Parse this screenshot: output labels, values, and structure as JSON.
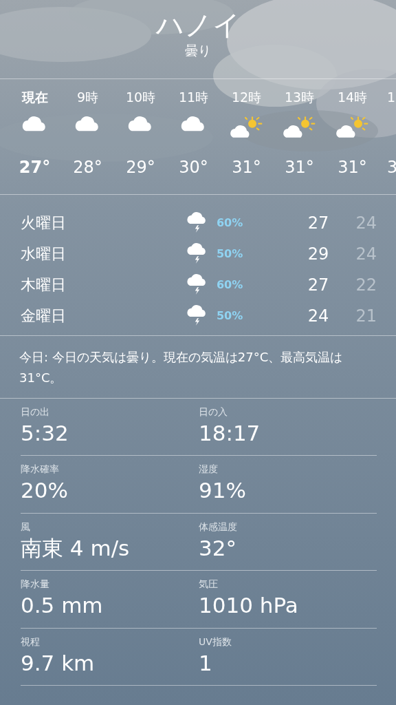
{
  "location": {
    "city": "ハノイ",
    "condition": "曇り"
  },
  "hourly": [
    {
      "time": "現在",
      "kind": "cloudy",
      "temp": "27°",
      "now": true
    },
    {
      "time": "9時",
      "kind": "cloudy",
      "temp": "28°",
      "now": false
    },
    {
      "time": "10時",
      "kind": "cloudy",
      "temp": "29°",
      "now": false
    },
    {
      "time": "11時",
      "kind": "cloudy",
      "temp": "30°",
      "now": false
    },
    {
      "time": "12時",
      "kind": "partly-sunny",
      "temp": "31°",
      "now": false
    },
    {
      "time": "13時",
      "kind": "partly-sunny",
      "temp": "31°",
      "now": false
    },
    {
      "time": "14時",
      "kind": "partly-sunny",
      "temp": "31°",
      "now": false
    },
    {
      "time": "1",
      "temp": "3",
      "now": false
    }
  ],
  "daily": [
    {
      "day": "火曜日",
      "kind": "thunderstorm",
      "chance": "60%",
      "high": "27",
      "low": "24"
    },
    {
      "day": "水曜日",
      "kind": "thunderstorm",
      "chance": "50%",
      "high": "29",
      "low": "24"
    },
    {
      "day": "木曜日",
      "kind": "thunderstorm",
      "chance": "60%",
      "high": "27",
      "low": "22"
    },
    {
      "day": "金曜日",
      "kind": "thunderstorm",
      "chance": "50%",
      "high": "24",
      "low": "21"
    }
  ],
  "summary": "今日: 今日の天気は曇り。現在の気温は27°C、最高気温は31°C。",
  "details": [
    [
      {
        "label": "日の出",
        "value": "5:32"
      },
      {
        "label": "日の入",
        "value": "18:17"
      }
    ],
    [
      {
        "label": "降水確率",
        "value": "20%"
      },
      {
        "label": "湿度",
        "value": "91%"
      }
    ],
    [
      {
        "label": "風",
        "value": "南東 4 m/s"
      },
      {
        "label": "体感温度",
        "value": "32°"
      }
    ],
    [
      {
        "label": "降水量",
        "value": "0.5 mm"
      },
      {
        "label": "気圧",
        "value": "1010 hPa"
      }
    ],
    [
      {
        "label": "視程",
        "value": "9.7 km"
      },
      {
        "label": "UV指数",
        "value": "1"
      }
    ]
  ]
}
